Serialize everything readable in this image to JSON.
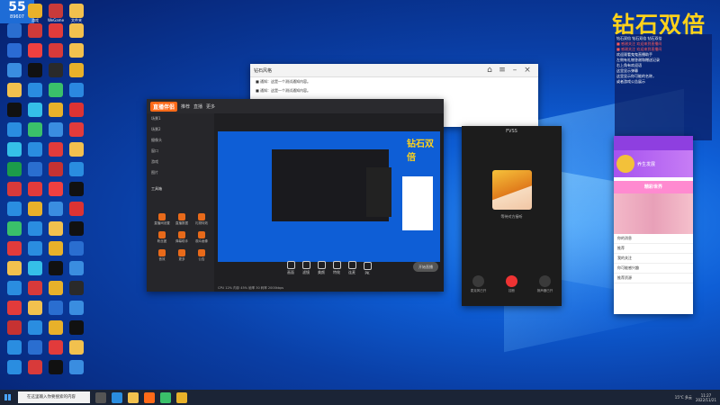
{
  "desktop": {
    "badge": {
      "big": "55",
      "top": "鬼助手",
      "num": "89607"
    },
    "overlay_title": "钻石双倍",
    "icons": [
      {
        "label": "此电脑",
        "color": "#3a8de0"
      },
      {
        "label": "游戏",
        "color": "#e8b12a"
      },
      {
        "label": "WeGame",
        "color": "#c83a3a"
      },
      {
        "label": "文件夹",
        "color": "#f2c14e"
      },
      {
        "label": "",
        "color": "#2a6ed0"
      },
      {
        "label": "",
        "color": "#cf3a3a"
      },
      {
        "label": "",
        "color": "#e23b3b"
      },
      {
        "label": "",
        "color": "#f2c14e"
      },
      {
        "label": "",
        "color": "#2b6bd3"
      },
      {
        "label": "",
        "color": "#f04040"
      },
      {
        "label": "",
        "color": "#d83a3a"
      },
      {
        "label": "",
        "color": "#f2c14e"
      },
      {
        "label": "",
        "color": "#3a8de0"
      },
      {
        "label": "",
        "color": "#111"
      },
      {
        "label": "",
        "color": "#2a2a2a"
      },
      {
        "label": "",
        "color": "#e8b12a"
      },
      {
        "label": "",
        "color": "#f2c14e"
      },
      {
        "label": "",
        "color": "#2a8de0"
      },
      {
        "label": "",
        "color": "#3ac06a"
      },
      {
        "label": "",
        "color": "#2b88e0"
      },
      {
        "label": "",
        "color": "#111"
      },
      {
        "label": "",
        "color": "#35c0e8"
      },
      {
        "label": "",
        "color": "#e8b12a"
      },
      {
        "label": "",
        "color": "#d33"
      },
      {
        "label": "",
        "color": "#2a8de0"
      },
      {
        "label": "",
        "color": "#3ac06a"
      },
      {
        "label": "",
        "color": "#3a8de0"
      },
      {
        "label": "",
        "color": "#e23b3b"
      },
      {
        "label": "",
        "color": "#35c0e8"
      },
      {
        "label": "",
        "color": "#2a8de0"
      },
      {
        "label": "",
        "color": "#e23b3b"
      },
      {
        "label": "",
        "color": "#f2c14e"
      },
      {
        "label": "",
        "color": "#1c9c4a"
      },
      {
        "label": "",
        "color": "#2a6ed0"
      },
      {
        "label": "",
        "color": "#c63232"
      },
      {
        "label": "",
        "color": "#2a8de0"
      },
      {
        "label": "",
        "color": "#d83a3a"
      },
      {
        "label": "",
        "color": "#e23b3b"
      },
      {
        "label": "",
        "color": "#f04040"
      },
      {
        "label": "",
        "color": "#111"
      },
      {
        "label": "",
        "color": "#2a8de0"
      },
      {
        "label": "",
        "color": "#e8b12a"
      },
      {
        "label": "",
        "color": "#3a8de0"
      },
      {
        "label": "",
        "color": "#d33"
      },
      {
        "label": "",
        "color": "#3ac06a"
      },
      {
        "label": "",
        "color": "#2a8de0"
      },
      {
        "label": "",
        "color": "#f2c14e"
      },
      {
        "label": "",
        "color": "#111"
      },
      {
        "label": "",
        "color": "#e23b3b"
      },
      {
        "label": "",
        "color": "#2a8de0"
      },
      {
        "label": "",
        "color": "#e8b12a"
      },
      {
        "label": "",
        "color": "#2a6ed0"
      },
      {
        "label": "",
        "color": "#f2c14e"
      },
      {
        "label": "",
        "color": "#35c0e8"
      },
      {
        "label": "",
        "color": "#111"
      },
      {
        "label": "",
        "color": "#3a8de0"
      },
      {
        "label": "",
        "color": "#2a8de0"
      },
      {
        "label": "",
        "color": "#d83a3a"
      },
      {
        "label": "",
        "color": "#e8b12a"
      },
      {
        "label": "",
        "color": "#2a2a2a"
      },
      {
        "label": "",
        "color": "#e23b3b"
      },
      {
        "label": "",
        "color": "#f2c14e"
      },
      {
        "label": "",
        "color": "#2a6ed0"
      },
      {
        "label": "",
        "color": "#3a8de0"
      },
      {
        "label": "",
        "color": "#c63232"
      },
      {
        "label": "",
        "color": "#2a8de0"
      },
      {
        "label": "",
        "color": "#e8b12a"
      },
      {
        "label": "",
        "color": "#111"
      },
      {
        "label": "",
        "color": "#2a8de0"
      },
      {
        "label": "",
        "color": "#2a6ed0"
      },
      {
        "label": "",
        "color": "#e23b3b"
      },
      {
        "label": "",
        "color": "#f2c14e"
      },
      {
        "label": "",
        "color": "#2a8de0"
      },
      {
        "label": "",
        "color": "#d83a3a"
      },
      {
        "label": "",
        "color": "#111"
      },
      {
        "label": "",
        "color": "#3a8de0"
      }
    ]
  },
  "side_panel": {
    "lines": [
      {
        "t": "钻石双倍 钻石双倍 钻石双倍",
        "c": ""
      },
      {
        "t": "■ 感谢关注 欢迎来到直播间",
        "c": "red"
      },
      {
        "t": "■ 感谢关注 欢迎来到直播间",
        "c": "red"
      },
      {
        "t": "",
        "c": ""
      },
      {
        "t": "欢迎观看鬼鬼直播助手",
        "c": ""
      },
      {
        "t": "左侧有礼物答谢和赠送记录",
        "c": ""
      },
      {
        "t": "右上角有欢迎语",
        "c": ""
      },
      {
        "t": "这里显示弹幕",
        "c": ""
      },
      {
        "t": "",
        "c": ""
      },
      {
        "t": "",
        "c": ""
      },
      {
        "t": "这里显示你可能的名称，",
        "c": ""
      },
      {
        "t": "或者游戏公告展示",
        "c": ""
      }
    ]
  },
  "win_qq": {
    "title": "钻石风格",
    "rows": [
      "■ 通知：这是一个测试通知内容。",
      "■ 通知：这是一个测试通知内容。"
    ]
  },
  "win_live": {
    "brand": "直播伴侣",
    "tabs": [
      "推荐",
      "直播",
      "更多"
    ],
    "sidebar": [
      "场景1",
      "场景2",
      "摄像头",
      "窗口",
      "游戏",
      "图片"
    ],
    "tools_label": "工具箱",
    "tools": [
      "直播间设置",
      "直播数据",
      "礼物特效",
      "粉丝团",
      "弹幕助手",
      "观众画像",
      "音效",
      "更多",
      "公告"
    ],
    "bottom": [
      "画面",
      "滤镜",
      "美颜",
      "特效",
      "连麦",
      "PK"
    ],
    "start": "开始直播",
    "status": "CPU 12%  内存 45%  帧率 30  码率 2000kbps"
  },
  "win_call": {
    "title": "FVSS",
    "status": "等待对方接听",
    "buttons": [
      "麦克风已开",
      "挂断",
      "扬声器已开"
    ]
  },
  "win_phone": {
    "name": "养生发展",
    "banner": "精彩世界",
    "items": [
      "你的消息",
      "推荐",
      "我的关注",
      "你可能感兴趣",
      "推荐资源"
    ]
  },
  "taskbar": {
    "search_placeholder": "在这里输入你要搜索的内容",
    "weather": "15°C 多云",
    "time": "11:27",
    "date": "2022/11/21"
  },
  "colors": {
    "accent": "#ffd21a",
    "taskbar": "#1b2436",
    "live_orange": "#ff6a18"
  }
}
